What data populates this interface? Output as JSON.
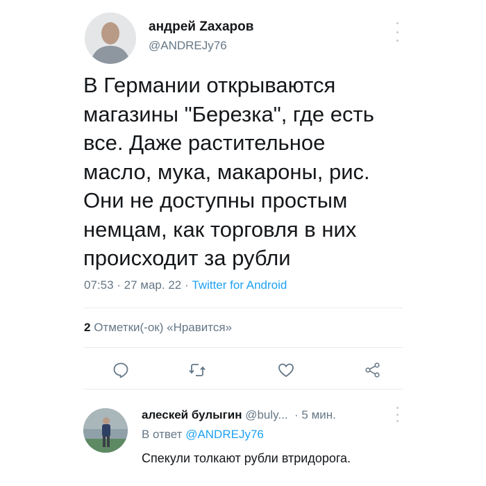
{
  "tweet": {
    "author_name": "андрей Zахаров",
    "author_handle": "@ANDREJy76",
    "text_lines": [
      "В Германии открываются",
      "магазины \"Березка\", где есть",
      "все. Даже растительное",
      "масло, мука, макароны, рис.",
      "Они не доступны простым",
      "немцам, как торговля в них",
      "происходит за рубли"
    ],
    "time": "07:53",
    "date": "27 мар. 22",
    "separator": " · ",
    "source": "Twitter for Android",
    "likes_count": "2",
    "likes_label": "Отметки(-ок) «Нравится»"
  },
  "actions": {
    "reply_icon": "comment-icon",
    "retweet_icon": "retweet-icon",
    "like_icon": "heart-icon",
    "share_icon": "share-icon"
  },
  "reply": {
    "author_name": "алескей булыгин",
    "author_handle": "@buly...",
    "time": "5 мин.",
    "replying_to_prefix": "В ответ",
    "replying_to_handle": "@ANDREJy76",
    "text": "Спекули толкают рубли втридорога."
  },
  "colors": {
    "text": "#14171a",
    "secondary": "#657786",
    "link": "#1da1f2",
    "divider": "#e6ecf0"
  }
}
